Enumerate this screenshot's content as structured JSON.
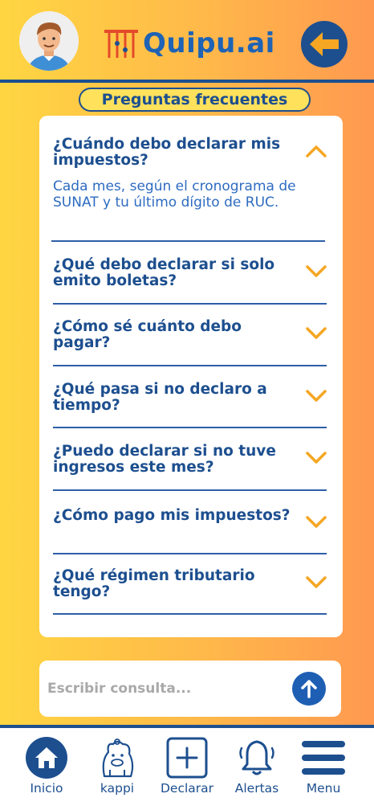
{
  "header": {
    "logo_text": "Quipu.ai",
    "back_icon": "arrow-left-icon"
  },
  "section_title": "Preguntas frecuentes",
  "faq": [
    {
      "question": "¿Cuándo debo declarar mis impuestos?",
      "answer": "Cada mes, según el cronograma de SUNAT y tu último dígito de RUC.",
      "expanded": true
    },
    {
      "question": "¿Qué debo declarar si solo emito boletas?",
      "expanded": false
    },
    {
      "question": "¿Cómo sé cuánto debo pagar?",
      "expanded": false
    },
    {
      "question": "¿Qué pasa si no declaro a tiempo?",
      "expanded": false
    },
    {
      "question": "¿Puedo declarar si no tuve ingresos este mes?",
      "expanded": false
    },
    {
      "question": "¿Cómo pago mis impuestos?",
      "expanded": false
    },
    {
      "question": "¿Qué régimen tributario tengo?",
      "expanded": false
    }
  ],
  "chat_input": {
    "placeholder": "Escribir consulta...",
    "value": ""
  },
  "bottom_nav": [
    {
      "label": "Inicio",
      "icon": "home-icon"
    },
    {
      "label": "kappi",
      "icon": "kappi-mascot-icon"
    },
    {
      "label": "Declarar",
      "icon": "plus-square-icon"
    },
    {
      "label": "Alertas",
      "icon": "bell-icon"
    },
    {
      "label": "Menu",
      "icon": "menu-icon"
    }
  ],
  "colors": {
    "primary": "#1D4F8F",
    "accent": "#F5A623",
    "text_blue": "#2E6BC0",
    "bg_start": "#FFD642",
    "bg_end": "#FF9950"
  }
}
